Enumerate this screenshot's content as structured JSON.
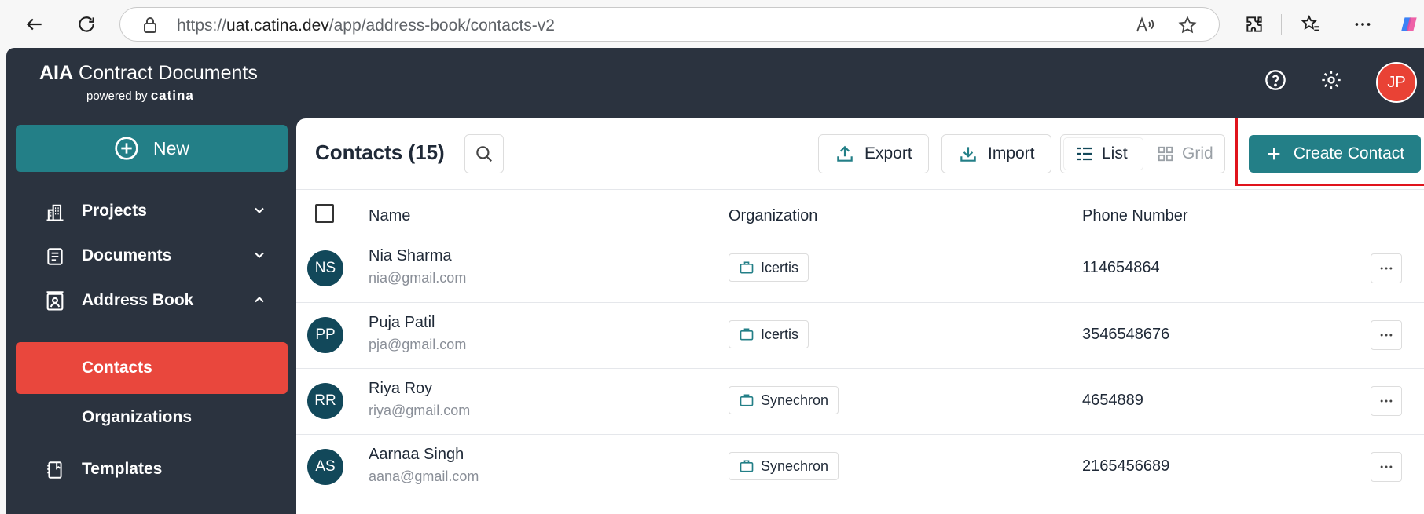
{
  "browser": {
    "url_prefix": "https://",
    "url_host": "uat.catina.dev",
    "url_path": "/app/address-book/contacts-v2"
  },
  "brand": {
    "title_bold": "AIA",
    "title_rest": " Contract Documents",
    "powered_by": "powered by ",
    "catina": "catina"
  },
  "header": {
    "user_initials": "JP"
  },
  "sidebar": {
    "new_label": "New",
    "items": [
      {
        "label": "Projects"
      },
      {
        "label": "Documents"
      },
      {
        "label": "Address Book"
      },
      {
        "label": "Contacts"
      },
      {
        "label": "Organizations"
      },
      {
        "label": "Templates"
      }
    ]
  },
  "content": {
    "title": "Contacts (15)",
    "export_label": "Export",
    "import_label": "Import",
    "list_label": "List",
    "grid_label": "Grid",
    "create_label": "Create Contact",
    "columns": {
      "name": "Name",
      "organization": "Organization",
      "phone": "Phone Number"
    },
    "rows": [
      {
        "initials": "NS",
        "name": "Nia Sharma",
        "email": "nia@gmail.com",
        "org": "Icertis",
        "phone": "114654864"
      },
      {
        "initials": "PP",
        "name": "Puja Patil",
        "email": "pja@gmail.com",
        "org": "Icertis",
        "phone": "3546548676"
      },
      {
        "initials": "RR",
        "name": "Riya Roy",
        "email": "riya@gmail.com",
        "org": "Synechron",
        "phone": "4654889"
      },
      {
        "initials": "AS",
        "name": "Aarnaa Singh",
        "email": "aana@gmail.com",
        "org": "Synechron",
        "phone": "2165456689"
      }
    ]
  },
  "colors": {
    "app_bg": "#2b333f",
    "accent": "#237f87",
    "active": "#e9473d",
    "avatar": "#12485a",
    "highlight": "#e0141d"
  }
}
